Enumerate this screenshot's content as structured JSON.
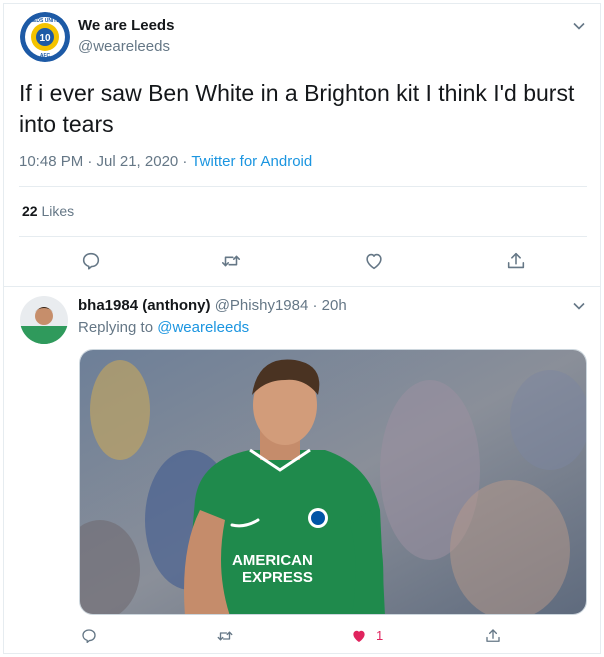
{
  "main_tweet": {
    "author_name": "We are Leeds",
    "author_handle": "@weareleeds",
    "avatar_text_top": "LEEDS UNITED",
    "avatar_text_bottom": "AFC",
    "text": "If i ever saw Ben White in a Brighton kit I think I'd burst into tears",
    "timestamp": "10:48 PM · Jul 21, 2020 · ",
    "source": "Twitter for Android",
    "likes_count": "22",
    "likes_label": " Likes"
  },
  "reply": {
    "author_name": "bha1984 (anthony)",
    "author_handle": " @Phishy1984 · 20h",
    "replying_prefix": "Replying to ",
    "replying_to": "@weareleeds",
    "media_text_line1": "AMERICAN",
    "media_text_line2": "EXPRESS",
    "like_count": "1"
  },
  "colors": {
    "accent": "#1b95e0",
    "muted": "#657786",
    "like_red": "#e0245e",
    "kit_green": "#1f8a4c"
  }
}
